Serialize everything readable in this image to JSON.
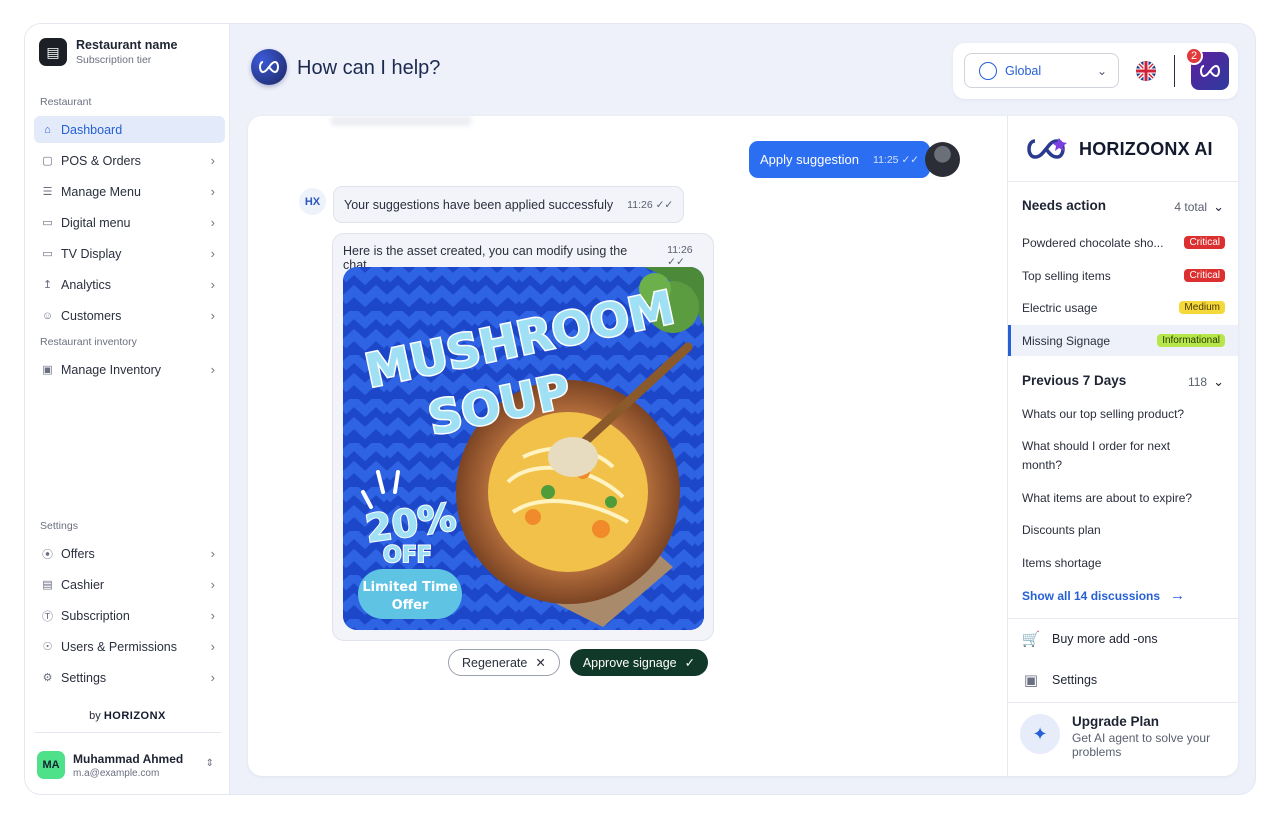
{
  "restaurant": {
    "name": "Restaurant name",
    "tier": "Subscription tier"
  },
  "sidebar": {
    "section_restaurant": "Restaurant",
    "items": [
      {
        "label": "Dashboard",
        "icon": "home-icon"
      },
      {
        "label": "POS & Orders",
        "icon": "box-icon"
      },
      {
        "label": "Manage Menu",
        "icon": "menu-icon"
      },
      {
        "label": "Digital menu",
        "icon": "screen-icon"
      },
      {
        "label": "TV Display",
        "icon": "tv-icon"
      },
      {
        "label": "Analytics",
        "icon": "chart-icon"
      },
      {
        "label": "Customers",
        "icon": "users-icon"
      }
    ],
    "section_inventory": "Restaurant inventory",
    "inventory_items": [
      {
        "label": "Manage Inventory",
        "icon": "truck-icon"
      }
    ],
    "section_settings": "Settings",
    "settings_items": [
      {
        "label": "Offers",
        "icon": "offer-icon"
      },
      {
        "label": "Cashier",
        "icon": "cashier-icon"
      },
      {
        "label": "Subscription",
        "icon": "dollar-icon"
      },
      {
        "label": "Users & Permissions",
        "icon": "user-permission-icon"
      },
      {
        "label": "Settings",
        "icon": "gear-icon"
      }
    ],
    "by_label": "by",
    "by_brand": "HORIZONX"
  },
  "user": {
    "initials": "MA",
    "name": "Muhammad Ahmed",
    "email": "m.a@example.com"
  },
  "header": {
    "title": "How can I help?",
    "region": "Global",
    "notifications": "2"
  },
  "chat": {
    "user_message": "Apply suggestion",
    "user_time": "11:25",
    "bot_initials": "HX",
    "bot_message": "Your suggestions have been applied successfuly",
    "bot_time": "11:26",
    "asset_message": "Here is the asset created, you can modify using the chat",
    "asset_time": "11:26",
    "poster": {
      "line1": "MUSHROOM",
      "line2": "SOUP",
      "discount": "20%",
      "discount_off": "OFF",
      "offer_line1": "Limited Time",
      "offer_line2": "Offer"
    },
    "regenerate_label": "Regenerate",
    "approve_label": "Approve signage"
  },
  "right_panel": {
    "brand": "HORIZOONX AI",
    "needs_action": {
      "title": "Needs action",
      "count": "4 total"
    },
    "alerts": [
      {
        "label": "Powdered chocolate sho...",
        "badge": "Critical",
        "level": "critical"
      },
      {
        "label": "Top selling items",
        "badge": "Critical",
        "level": "critical"
      },
      {
        "label": "Electric usage",
        "badge": "Medium",
        "level": "medium"
      },
      {
        "label": "Missing Signage",
        "badge": "Informational",
        "level": "informational"
      }
    ],
    "previous": {
      "title": "Previous 7 Days",
      "count": "118"
    },
    "history": [
      "Whats our top selling product?",
      "What should I order for next month?",
      "What items are about to expire?",
      "Discounts plan",
      "Items shortage"
    ],
    "show_all": "Show all 14 discussions",
    "buy_addons": "Buy more add -ons",
    "settings": "Settings",
    "upgrade_title": "Upgrade Plan",
    "upgrade_desc": "Get AI agent to solve your problems"
  },
  "colors": {
    "accent": "#2560d6",
    "user_bubble": "#2c6ef2",
    "approve": "#10392a",
    "critical": "#dc2f2f",
    "medium": "#f5d83a",
    "informational": "#b7e64a"
  }
}
